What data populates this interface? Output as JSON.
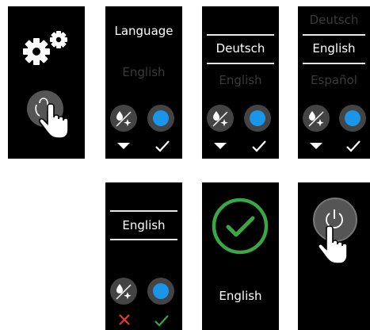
{
  "screen2": {
    "title": "Language",
    "option": "English"
  },
  "screen3": {
    "selected": "Deutsch",
    "next": "English"
  },
  "screen4": {
    "prev": "Deutsch",
    "selected": "English",
    "next": "Español"
  },
  "screen5": {
    "selected": "English"
  },
  "screen6": {
    "confirmed": "English"
  },
  "colors": {
    "accent_blue": "#1a95e8",
    "confirm_green": "#3aa645",
    "cancel_red": "#e53935"
  },
  "icons": [
    "gear-icon",
    "touch-hand-icon",
    "water-sparkle-icon",
    "select-dot-icon",
    "triangle-down-icon",
    "check-icon",
    "x-icon",
    "power-icon"
  ]
}
